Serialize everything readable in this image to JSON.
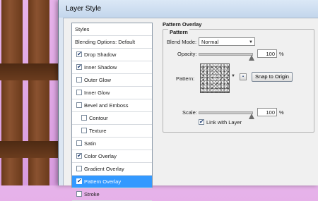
{
  "window": {
    "title": "Layer Style"
  },
  "styles": {
    "header": "Styles",
    "blending": "Blending Options: Default",
    "items": [
      {
        "label": "Drop Shadow",
        "checked": true,
        "indent": false,
        "selected": false
      },
      {
        "label": "Inner Shadow",
        "checked": true,
        "indent": false,
        "selected": false
      },
      {
        "label": "Outer Glow",
        "checked": false,
        "indent": false,
        "selected": false
      },
      {
        "label": "Inner Glow",
        "checked": false,
        "indent": false,
        "selected": false
      },
      {
        "label": "Bevel and Emboss",
        "checked": false,
        "indent": false,
        "selected": false
      },
      {
        "label": "Contour",
        "checked": false,
        "indent": true,
        "selected": false
      },
      {
        "label": "Texture",
        "checked": false,
        "indent": true,
        "selected": false
      },
      {
        "label": "Satin",
        "checked": false,
        "indent": false,
        "selected": false
      },
      {
        "label": "Color Overlay",
        "checked": true,
        "indent": false,
        "selected": false
      },
      {
        "label": "Gradient Overlay",
        "checked": false,
        "indent": false,
        "selected": false
      },
      {
        "label": "Pattern Overlay",
        "checked": true,
        "indent": false,
        "selected": true
      },
      {
        "label": "Stroke",
        "checked": false,
        "indent": false,
        "selected": false
      }
    ]
  },
  "overlay": {
    "section_title": "Pattern Overlay",
    "group_title": "Pattern",
    "blend_mode_label": "Blend Mode:",
    "blend_mode_value": "Normal",
    "opacity_label": "Opacity:",
    "opacity_value": "100",
    "opacity_unit": "%",
    "pattern_label": "Pattern:",
    "snap_button": "Snap to Origin",
    "scale_label": "Scale:",
    "scale_value": "100",
    "scale_unit": "%",
    "link_label": "Link with Layer",
    "link_checked": true
  },
  "colors": {
    "selection": "#3399ff",
    "background": "#e0a8e6"
  }
}
